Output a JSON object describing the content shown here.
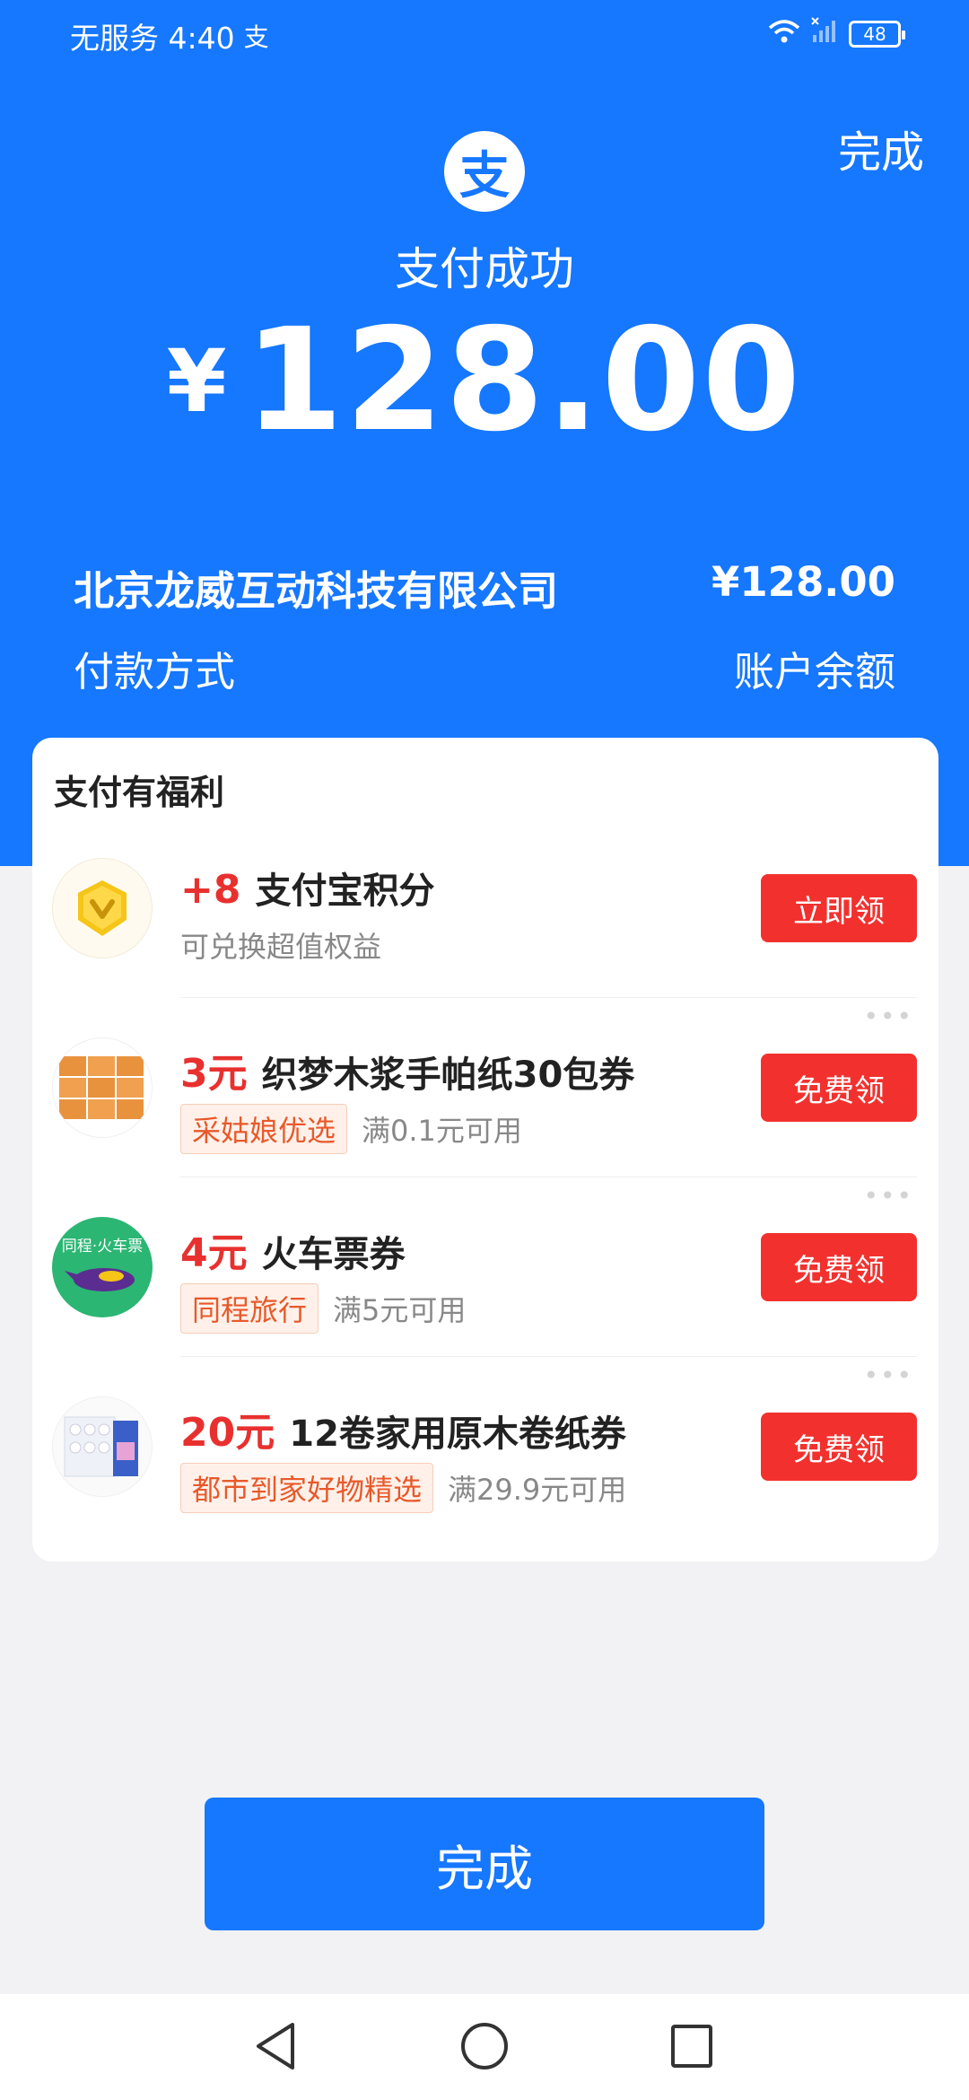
{
  "status_bar": {
    "carrier_time": "无服务 4:40",
    "alipay_glyph": "支",
    "battery": "48",
    "icons": [
      "wifi-icon",
      "no-signal-icon",
      "battery-icon"
    ]
  },
  "header": {
    "done_label": "完成",
    "logo_glyph": "支",
    "status_text": "支付成功",
    "currency": "¥",
    "amount": "128.00"
  },
  "payment_info": {
    "merchant": "北京龙威互动科技有限公司",
    "merchant_amount": "¥128.00",
    "method_label": "付款方式",
    "method_value": "账户余额"
  },
  "benefits": {
    "title": "支付有福利",
    "items": [
      {
        "amount": "+8",
        "name": "支付宝积分",
        "tag": "",
        "condition": "可兑换超值权益",
        "button": "立即领",
        "icon": "points-coin-icon"
      },
      {
        "amount": "3元",
        "name": "织梦木浆手帕纸30包券",
        "tag": "采姑娘优选",
        "condition": "满0.1元可用",
        "button": "免费领",
        "icon": "tissue-boxes-icon"
      },
      {
        "amount": "4元",
        "name": "火车票券",
        "tag": "同程旅行",
        "condition": "满5元可用",
        "button": "免费领",
        "icon": "train-ticket-icon",
        "icon_text": "同程·火车票"
      },
      {
        "amount": "20元",
        "name": "12卷家用原木卷纸券",
        "tag": "都市到家好物精选",
        "condition": "满29.9元可用",
        "button": "免费领",
        "icon": "toilet-paper-icon"
      }
    ]
  },
  "footer": {
    "done_label": "完成"
  },
  "nav_bar": {
    "icons": [
      "back-icon",
      "home-icon",
      "recents-icon"
    ]
  },
  "colors": {
    "brand_blue": "#1677ff",
    "red": "#f2312e",
    "tag_orange": "#e8592a"
  }
}
